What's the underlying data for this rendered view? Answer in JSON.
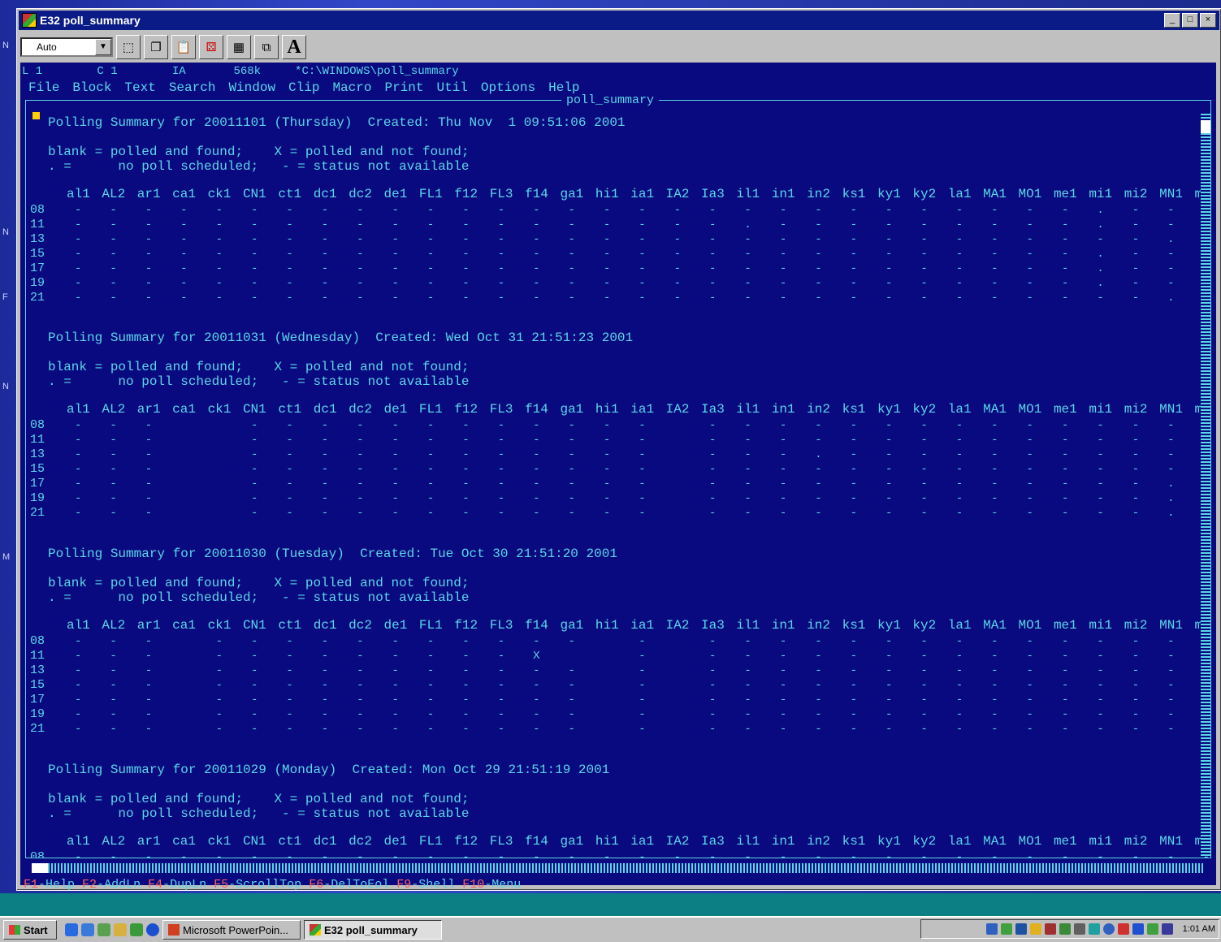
{
  "window": {
    "title": "E32 poll_summary",
    "buttons": [
      "_",
      "□",
      "×"
    ]
  },
  "toolbar": {
    "font_combo_value": "Auto",
    "tools": [
      "select-icon",
      "copy-icon",
      "paste-icon",
      "dice-icon",
      "calc-icon",
      "window-icon",
      "font-icon"
    ],
    "font_button_label": "A"
  },
  "editor": {
    "status_line": "L 1        C 1        IA       568k     *C:\\WINDOWS\\poll_summary",
    "menu": [
      "File",
      "Block",
      "Text",
      "Search",
      "Window",
      "Clip",
      "Macro",
      "Print",
      "Util",
      "Options",
      "Help"
    ],
    "frame_title": "poll_summary",
    "columns": [
      "al1",
      "AL2",
      "ar1",
      "ca1",
      "ck1",
      "CN1",
      "ct1",
      "dc1",
      "dc2",
      "de1",
      "FL1",
      "f12",
      "FL3",
      "f14",
      "ga1",
      "hi1",
      "ia1",
      "IA2",
      "Ia3",
      "il1",
      "in1",
      "in2",
      "ks1",
      "ky1",
      "ky2",
      "la1",
      "MA1",
      "MO1",
      "me1",
      "mi1",
      "mi2",
      "MN1",
      "mo"
    ],
    "row_labels": [
      "08",
      "11",
      "13",
      "15",
      "17",
      "19",
      "21"
    ],
    "legend_line1": "blank = polled and found;    X = polled and not found;",
    "legend_line2": ". =      no poll scheduled;   - = status not available",
    "sections": [
      {
        "header": "Polling Summary for 20011101 (Thursday)  Created: Thu Nov  1 09:51:06 2001",
        "rows": [
          "-----------------------------.---",
          "-------------------.---------.---",
          "-------------------------------.-",
          "-----------------------------.---",
          "-----------------------------.---",
          "-----------------------------.---",
          "-------------------------------.-"
        ]
      },
      {
        "header": "Polling Summary for 20011031 (Wednesday)  Created: Wed Oct 31 21:51:23 2001",
        "rows": [
          "---  ------------ ---------------",
          "---  ------------ ---------------",
          "---  ------------ ---.-----------",
          "---  ------------ ---------------",
          "---  ------------ -------------.-",
          "---  ------------ -------------.-",
          "---  ------------ -------------.-"
        ]
      },
      {
        "header": "Polling Summary for 20011030 (Tuesday)  Created: Tue Oct 30 21:51:20 2001",
        "rows": [
          "--- ----------- - ---------------",
          "--- ---------X  - ---------------",
          "--- ----------- - ---------------",
          "--- ----------- - ---------------",
          "--- ----------- - ---------------",
          "--- ----------- - ---------------",
          "--- ----------- - ---------------"
        ]
      },
      {
        "header": "Polling Summary for 20011029 (Monday)  Created: Mon Oct 29 21:51:19 2001",
        "rows": [
          "---------------------------------"
        ]
      }
    ],
    "fkeys": [
      {
        "key": "F1",
        "label": "-Help"
      },
      {
        "key": "F2",
        "label": "-AddLn"
      },
      {
        "key": "F4",
        "label": "-DupLn"
      },
      {
        "key": "F5",
        "label": "-ScrollTop"
      },
      {
        "key": "F6",
        "label": "-DelToEol"
      },
      {
        "key": "F9",
        "label": "-Shell"
      },
      {
        "key": "F10",
        "label": "-Menu"
      }
    ]
  },
  "taskbar": {
    "start_label": "Start",
    "tasks": [
      {
        "label": "Microsoft PowerPoin...",
        "active": false
      },
      {
        "label": "E32 poll_summary",
        "active": true
      }
    ],
    "clock": "1:01 AM"
  },
  "desktop_marks": [
    "N",
    "N",
    "F",
    "N",
    "M"
  ]
}
